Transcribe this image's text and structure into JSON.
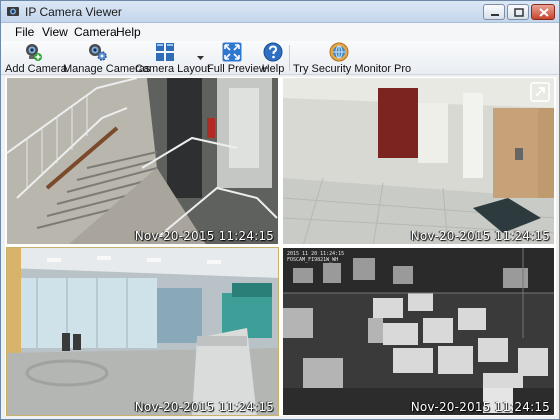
{
  "window": {
    "title": "IP Camera Viewer"
  },
  "menu": [
    "File",
    "View",
    "Camera",
    "Help"
  ],
  "toolbar": {
    "add_camera": "Add Camera",
    "manage_cameras": "Manage Cameras",
    "camera_layout": "Camera Layout",
    "full_preview": "Full Preview",
    "help": "Help",
    "try_monitor": "Try Security Monitor Pro"
  },
  "cameras": [
    {
      "timestamp": "Nov-20-2015 11:24:15"
    },
    {
      "timestamp": "Nov-20-2015 11:24:15"
    },
    {
      "timestamp": "Nov-20-2015 11:24:15"
    },
    {
      "timestamp": "Nov-20-2015 11:24:15",
      "osd_line1": "2015 11 20 11:24:15",
      "osd_line2": "FOSCAM_FI9821W_WH"
    }
  ],
  "icons": {
    "add_camera": "webcam-plus-icon",
    "manage_cameras": "webcam-gear-icon",
    "camera_layout": "grid-layout-icon",
    "full_preview": "expand-arrows-icon",
    "help": "question-circle-icon",
    "try_monitor": "shield-globe-icon",
    "expand": "expand-corner-icon"
  },
  "colors": {
    "accent": "#1f5fb8",
    "titlebar": "#c4d6ec",
    "close": "#c8442d"
  }
}
